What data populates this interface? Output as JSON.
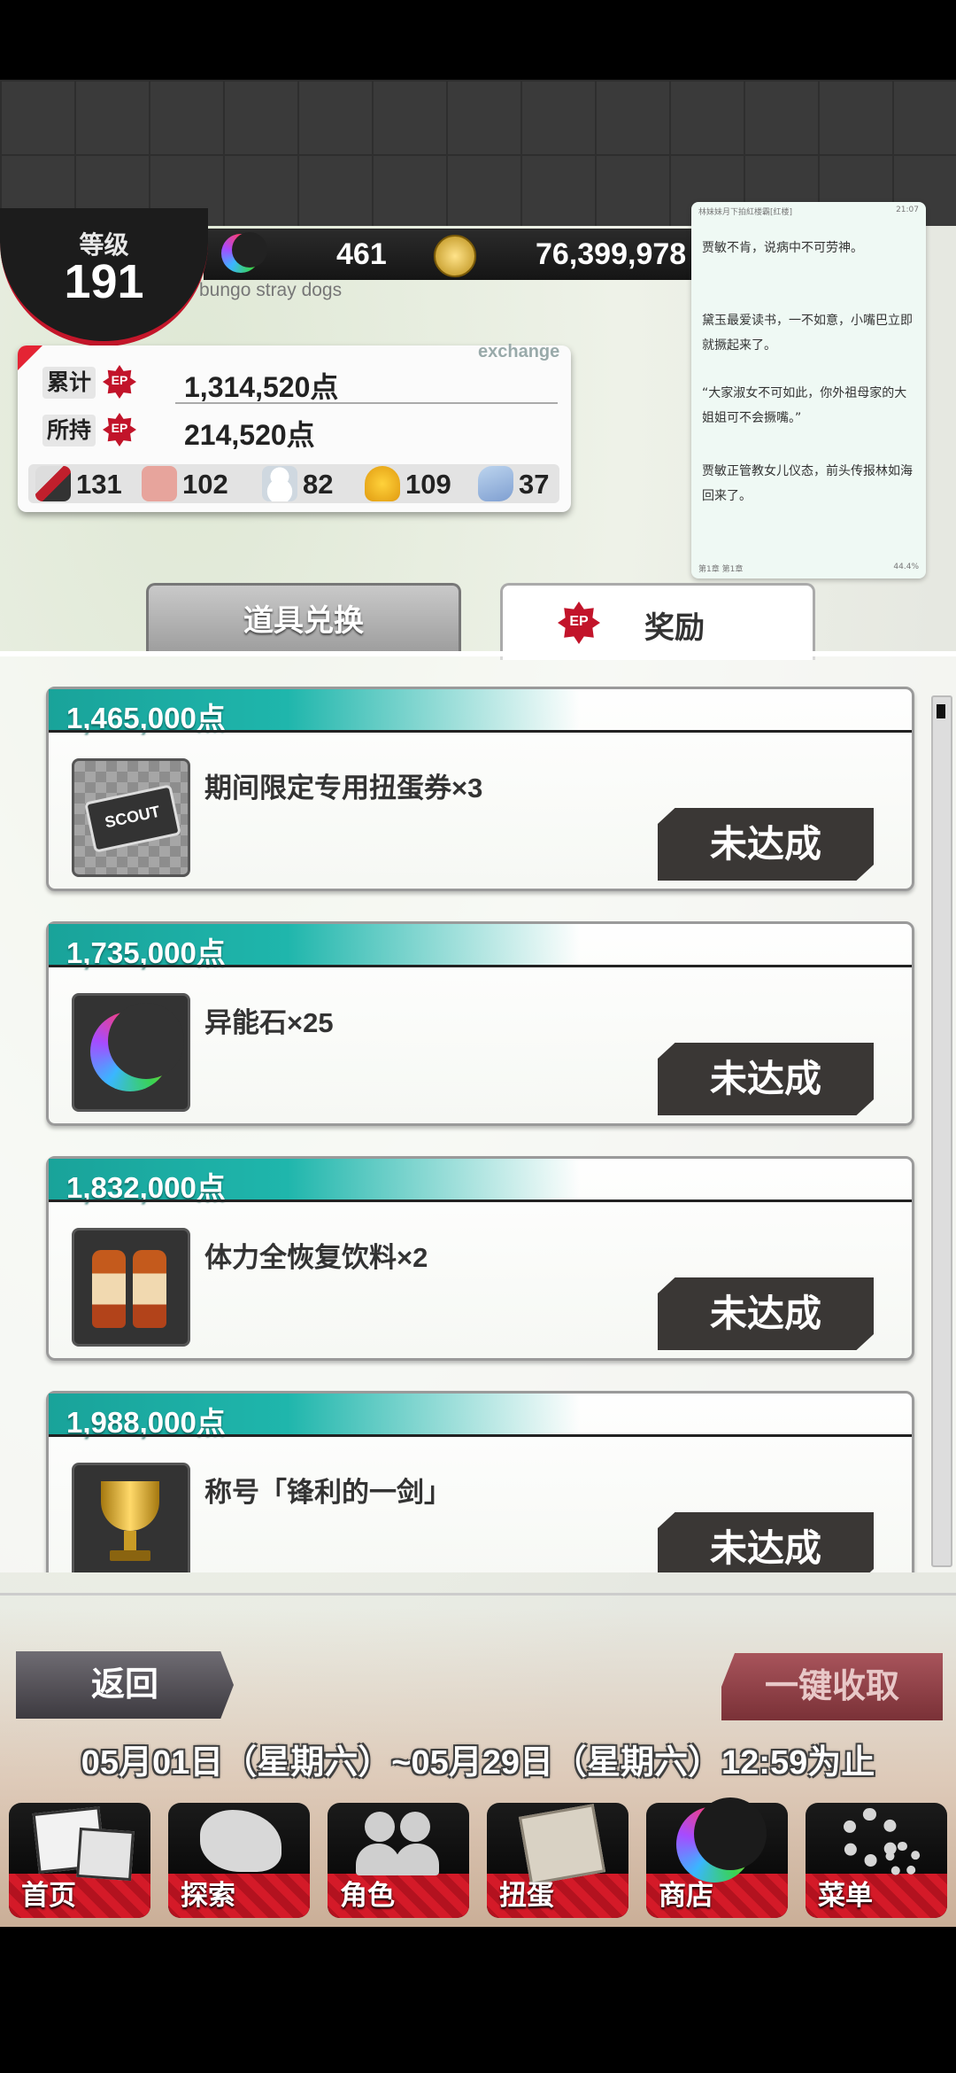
{
  "header": {
    "level_label": "等级",
    "level": "191",
    "stones": "461",
    "coins": "76,399,978",
    "subtitle": "bungo stray dogs"
  },
  "points": {
    "exchange_tag": "exchange",
    "ep_badge": "EP",
    "total_label": "累计",
    "total_value": "1,314,520点",
    "owned_label": "所持",
    "owned_value": "214,520点",
    "items": [
      {
        "icon": "sword-icon",
        "count": "131"
      },
      {
        "icon": "cloth-icon",
        "count": "102"
      },
      {
        "icon": "snowman-icon",
        "count": "82"
      },
      {
        "icon": "bell-icon",
        "count": "109"
      },
      {
        "icon": "shoe-icon",
        "count": "37"
      }
    ]
  },
  "reader": {
    "title": "林妹妹月下拍紅楼霸[红楼]",
    "time": "21:07",
    "paragraphs": [
      "贾敏不肯，说病中不可劳神。",
      "黛玉最爱读书，一不如意，小嘴巴立即就撅起来了。",
      "“大家淑女不可如此，你外祖母家的大姐姐可不会撅嘴。”",
      "贾敏正管教女儿仪态，前头传报林如海回来了。"
    ],
    "chapter": "第1章  第1章",
    "progress": "44.4%"
  },
  "tabs": {
    "exchange": "道具兑换",
    "reward": "奖励"
  },
  "rewards": [
    {
      "points": "1,465,000点",
      "name": "期间限定专用扭蛋券×3",
      "icon": "scout-ticket-icon",
      "status": "未达成"
    },
    {
      "points": "1,735,000点",
      "name": "异能石×25",
      "icon": "rainbow-moon-icon",
      "status": "未达成"
    },
    {
      "points": "1,832,000点",
      "name": "体力全恢复饮料×2",
      "icon": "drink-bottles-icon",
      "status": "未达成"
    },
    {
      "points": "1,988,000点",
      "name": "称号「锋利的一剑」",
      "icon": "trophy-icon",
      "status": "未达成"
    }
  ],
  "actions": {
    "back": "返回",
    "collect_all": "一键收取"
  },
  "period": "05月01日（星期六）~05月29日（星期六）12:59为止",
  "nav": [
    "首页",
    "探索",
    "角色",
    "扭蛋",
    "商店",
    "菜单"
  ],
  "colors": {
    "accent_red": "#c2142a",
    "teal_header": "#1fb6ac",
    "button_dark": "#3a3735"
  }
}
